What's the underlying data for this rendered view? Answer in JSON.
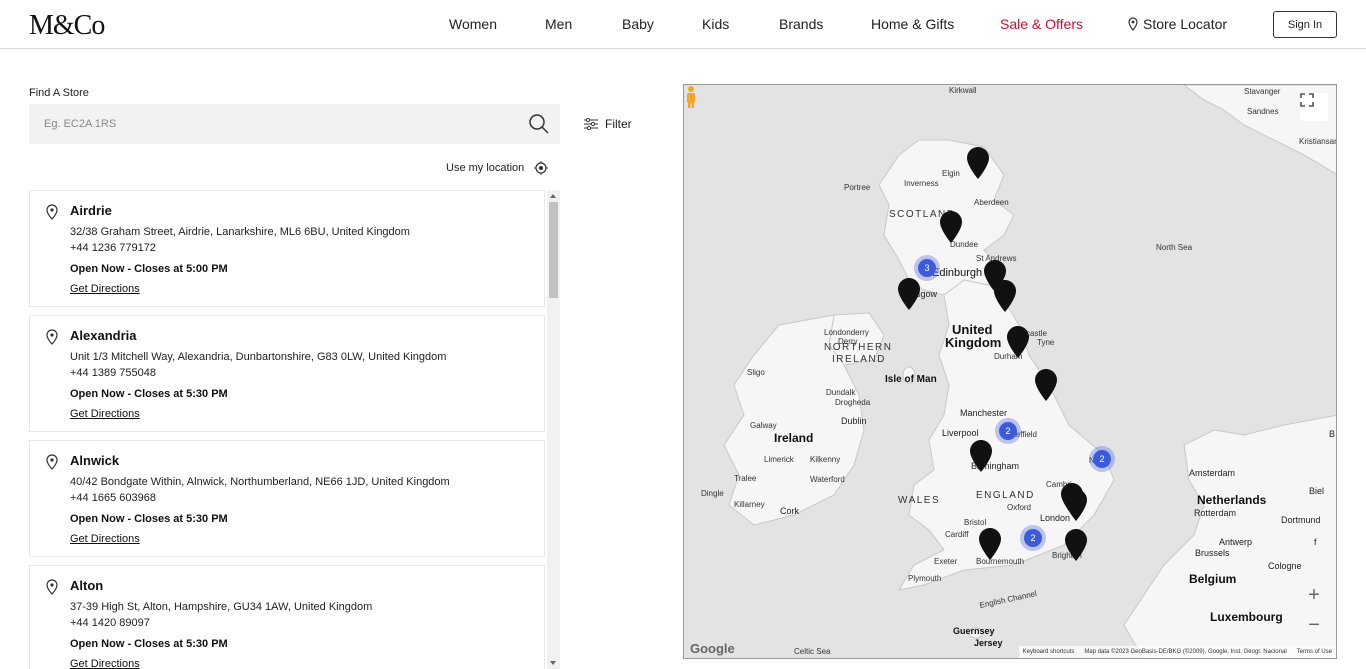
{
  "header": {
    "logo": "M&Co",
    "nav": [
      "Women",
      "Men",
      "Baby",
      "Kids",
      "Brands",
      "Home & Gifts",
      "Sale & Offers"
    ],
    "store_locator": "Store Locator",
    "sign_in": "Sign In",
    "sale_color": "#c8102e"
  },
  "finder": {
    "label": "Find A Store",
    "placeholder": "Eg. EC2A 1RS",
    "filter": "Filter",
    "use_location": "Use my location"
  },
  "stores": [
    {
      "name": "Airdrie",
      "address": "32/38 Graham Street, Airdrie, Lanarkshire, ML6 6BU, United Kingdom",
      "phone": "+44 1236 779172",
      "hours": "Open Now - Closes at 5:00 PM",
      "directions": "Get Directions"
    },
    {
      "name": "Alexandria",
      "address": "Unit 1/3 Mitchell Way, Alexandria, Dunbartonshire, G83 0LW, United Kingdom",
      "phone": "+44 1389 755048",
      "hours": "Open Now - Closes at 5:30 PM",
      "directions": "Get Directions"
    },
    {
      "name": "Alnwick",
      "address": "40/42 Bondgate Within, Alnwick, Northumberland, NE66 1JD, United Kingdom",
      "phone": "+44 1665 603968",
      "hours": "Open Now - Closes at 5:30 PM",
      "directions": "Get Directions"
    },
    {
      "name": "Alton",
      "address": "37-39 High St, Alton, Hampshire, GU34 1AW, United Kingdom",
      "phone": "+44 1420 89097",
      "hours": "Open Now - Closes at 5:30 PM",
      "directions": "Get Directions"
    }
  ],
  "map": {
    "labels": {
      "kirkwall": "Kirkwall",
      "stavanger": "Stavanger",
      "sandnes": "Sandnes",
      "kristiansand": "Kristiansand",
      "elgin": "Elgin",
      "portree": "Portree",
      "inverness": "Inverness",
      "aberdeen": "Aberdeen",
      "scotland": "SCOTLAND",
      "dundee": "Dundee",
      "north_sea": "North Sea",
      "st_andrews": "St Andrews",
      "edinburgh": "Edinburgh",
      "glasgow": "sgow",
      "united_kingdom_1": "United",
      "united_kingdom_2": "Kingdom",
      "londonderry": "Londonderry",
      "derry": "Derry",
      "northern_ireland_1": "NORTHERN",
      "northern_ireland_2": "IRELAND",
      "castle_tyne": "castle",
      "tyne": "Tyne",
      "durham": "Durham",
      "sligo": "Sligo",
      "isle_of_man": "Isle of Man",
      "dundalk": "Dundalk",
      "drogheda": "Drogheda",
      "galway": "Galway",
      "dublin": "Dublin",
      "manchester": "Manchester",
      "ireland": "Ireland",
      "liverpool": "Liverpool",
      "sheffield": "Sheffield",
      "limerick": "Limerick",
      "kilkenny": "Kilkenny",
      "birmingham": "Birmingham",
      "norwich": "N",
      "tralee": "Tralee",
      "waterford": "Waterford",
      "england": "ENGLAND",
      "cambridge": "Cambri",
      "amsterdam": "Amsterdam",
      "dingle": "Dingle",
      "killarney": "Killarney",
      "cork": "Cork",
      "wales": "WALES",
      "oxford": "Oxford",
      "netherlands": "Netherlands",
      "rotterdam": "Rotterdam",
      "bristol": "Bristol",
      "london": "London",
      "cardiff": "Cardiff",
      "dortmund": "Dortmund",
      "bielefeld": "Biel",
      "antwerp": "Antwerp",
      "brussels": "Brussels",
      "cologne": "Cologne",
      "exeter": "Exeter",
      "bournemouth": "Bournemouth",
      "brighton": "Brighton",
      "belgium": "Belgium",
      "plymouth": "Plymouth",
      "english_channel": "English Channel",
      "luxembourg": "Luxembourg",
      "guernsey": "Guernsey",
      "jersey": "Jersey",
      "celtic_sea": "Celtic Sea",
      "b_edge": "B",
      "f_edge": "f"
    },
    "clusters": [
      {
        "count": "3"
      },
      {
        "count": "2"
      },
      {
        "count": "2"
      },
      {
        "count": "2"
      }
    ],
    "google": "Google",
    "footer": {
      "shortcuts": "Keyboard shortcuts",
      "data": "Map data ©2023 GeoBasis-DE/BKG (©2009), Google, Inst. Geogr. Nacional",
      "terms": "Terms of Use"
    },
    "zoom_in": "+",
    "zoom_out": "−"
  }
}
